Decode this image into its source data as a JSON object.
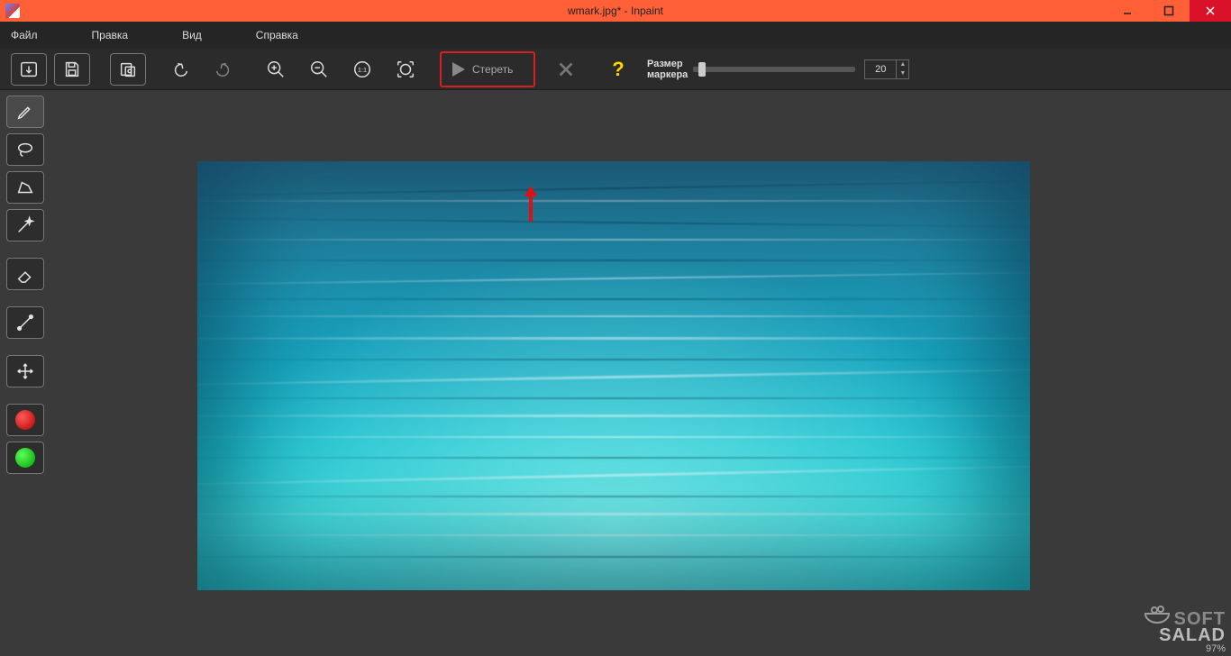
{
  "window": {
    "title": "wmark.jpg* - Inpaint"
  },
  "menu": {
    "file": "Файл",
    "edit": "Правка",
    "view": "Вид",
    "help": "Справка"
  },
  "toolbar": {
    "erase_label": "Стереть",
    "marker_label_line1": "Размер",
    "marker_label_line2": "маркера",
    "marker_size_value": "20"
  },
  "watermark": {
    "soft": "SOFT",
    "salad": "SALAD",
    "percent": "97%"
  }
}
